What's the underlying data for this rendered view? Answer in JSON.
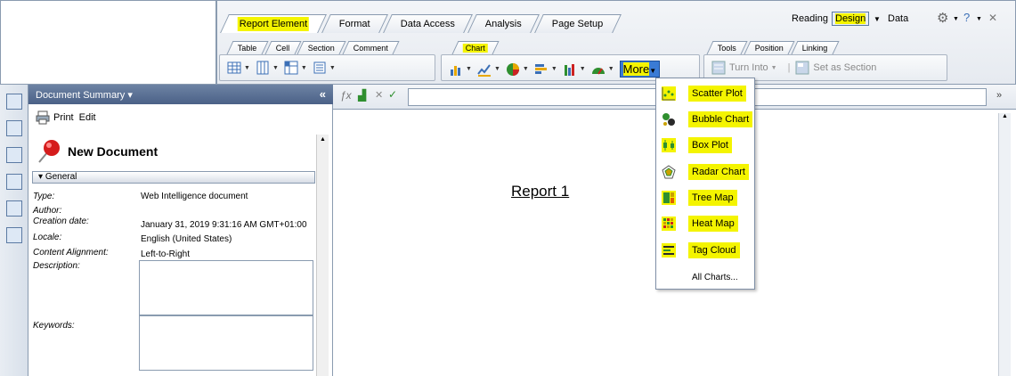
{
  "main_tabs": [
    {
      "label": "Report Element",
      "active": true
    },
    {
      "label": "Format"
    },
    {
      "label": "Data Access"
    },
    {
      "label": "Analysis"
    },
    {
      "label": "Page Setup"
    }
  ],
  "view": {
    "reading": "Reading",
    "design": "Design",
    "data": "Data"
  },
  "sub_tabs": {
    "left": [
      "Table",
      "Cell",
      "Section",
      "Comment"
    ],
    "chart": "Chart",
    "right": [
      "Tools",
      "Position",
      "Linking"
    ]
  },
  "toolbar": {
    "more_label": "More",
    "turn_into": "Turn Into",
    "set_as_section": "Set as Section"
  },
  "panel": {
    "title": "Document Summary",
    "print": "Print",
    "edit": "Edit",
    "doc_name": "New Document",
    "section": "General",
    "fields": {
      "type_label": "Type:",
      "type_value": "Web Intelligence document",
      "author_label": "Author:",
      "creation_label": "Creation date:",
      "creation_value": "January 31, 2019 9:31:16 AM GMT+01:00",
      "locale_label": "Locale:",
      "locale_value": "English (United States)",
      "alignment_label": "Content Alignment:",
      "alignment_value": "Left-to-Right",
      "description_label": "Description:",
      "keywords_label": "Keywords:"
    }
  },
  "report": {
    "title": "Report 1"
  },
  "more_menu": [
    {
      "label": "Scatter Plot",
      "icon": "scatter-plot-icon"
    },
    {
      "label": "Bubble Chart",
      "icon": "bubble-chart-icon"
    },
    {
      "label": "Box Plot",
      "icon": "box-plot-icon"
    },
    {
      "label": "Radar Chart",
      "icon": "radar-chart-icon"
    },
    {
      "label": "Tree Map",
      "icon": "tree-map-icon"
    },
    {
      "label": "Heat Map",
      "icon": "heat-map-icon"
    },
    {
      "label": "Tag Cloud",
      "icon": "tag-cloud-icon"
    },
    {
      "label": "All Charts..."
    }
  ],
  "colors": {
    "highlight": "#f4f400",
    "panel_header": "#4b6187",
    "more_active": "#3a7bd5"
  }
}
